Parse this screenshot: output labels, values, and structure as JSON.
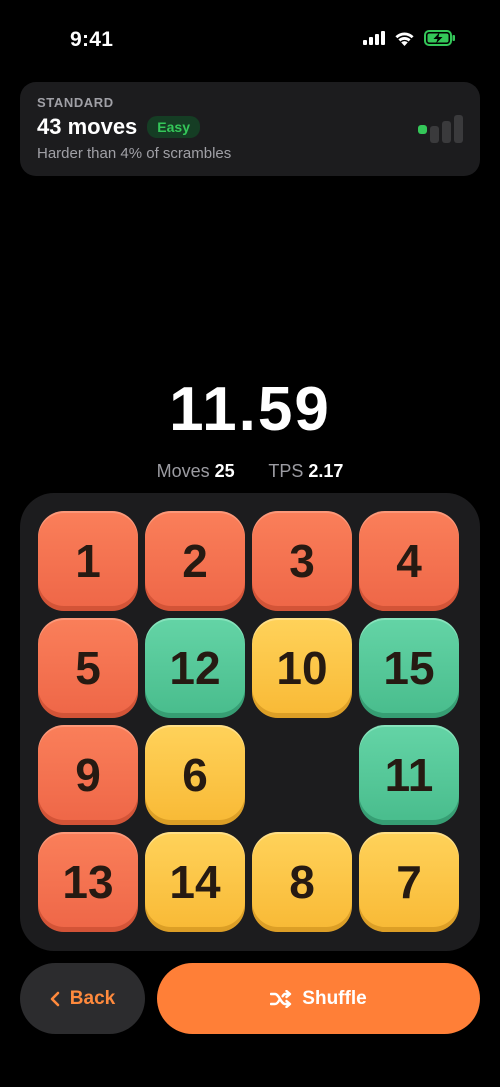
{
  "status_bar": {
    "time": "9:41",
    "icons": [
      "cellular-signal-icon",
      "wifi-icon",
      "battery-charging-icon"
    ]
  },
  "info_card": {
    "category": "STANDARD",
    "moves_label": "43 moves",
    "difficulty": "Easy",
    "caption": "Harder than 4% of scrambles",
    "difficulty_level": 1,
    "difficulty_levels_total": 4,
    "colors": {
      "badge_text": "#34c759",
      "meter_active": "#34c759",
      "meter_inactive": "#3a3a3c"
    }
  },
  "timer": {
    "value": "11.59"
  },
  "stats": {
    "moves_label": "Moves",
    "moves_value": "25",
    "tps_label": "TPS",
    "tps_value": "2.17"
  },
  "board": {
    "size": 4,
    "tiles": [
      [
        {
          "n": "1",
          "color": "red"
        },
        {
          "n": "2",
          "color": "red"
        },
        {
          "n": "3",
          "color": "red"
        },
        {
          "n": "4",
          "color": "red"
        }
      ],
      [
        {
          "n": "5",
          "color": "red"
        },
        {
          "n": "12",
          "color": "green"
        },
        {
          "n": "10",
          "color": "yellow"
        },
        {
          "n": "15",
          "color": "green"
        }
      ],
      [
        {
          "n": "9",
          "color": "red"
        },
        {
          "n": "6",
          "color": "yellow"
        },
        null,
        {
          "n": "11",
          "color": "green"
        }
      ],
      [
        {
          "n": "13",
          "color": "red"
        },
        {
          "n": "14",
          "color": "yellow"
        },
        {
          "n": "8",
          "color": "yellow"
        },
        {
          "n": "7",
          "color": "yellow"
        }
      ]
    ],
    "colors": {
      "red": "#f57452",
      "green": "#56c899",
      "yellow": "#fcc548",
      "board_bg": "#1c1c1e"
    }
  },
  "actions": {
    "back_label": "Back",
    "back_icon": "chevron-left-icon",
    "shuffle_label": "Shuffle",
    "shuffle_icon": "shuffle-icon",
    "colors": {
      "accent": "#ff7f37"
    }
  }
}
